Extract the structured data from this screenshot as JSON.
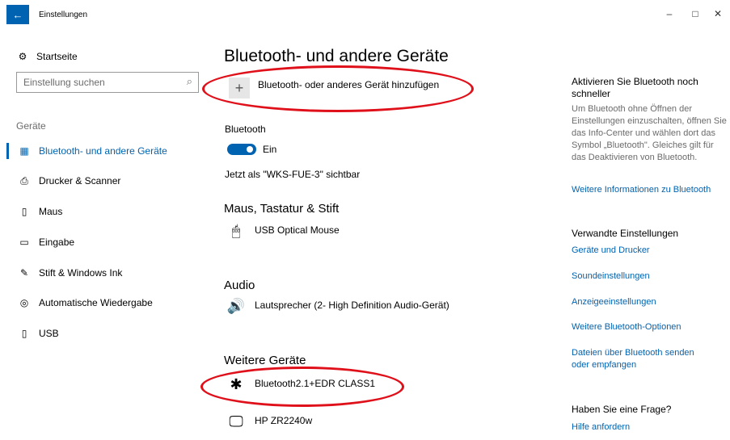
{
  "window": {
    "title": "Einstellungen",
    "back": "←",
    "controls": {
      "minimize": "–",
      "maximize": "□",
      "close": "✕"
    }
  },
  "sidebar": {
    "home": {
      "icon": "gear-icon",
      "glyph": "⚙",
      "label": "Startseite"
    },
    "search": {
      "placeholder": "Einstellung suchen",
      "glyph": "⌕"
    },
    "section": "Geräte",
    "items": [
      {
        "label": "Bluetooth- und andere Geräte",
        "icon": "devices-icon",
        "glyph": "▦",
        "active": true
      },
      {
        "label": "Drucker & Scanner",
        "icon": "printer-icon",
        "glyph": "⎙",
        "active": false
      },
      {
        "label": "Maus",
        "icon": "mouse-icon",
        "glyph": "▯",
        "active": false
      },
      {
        "label": "Eingabe",
        "icon": "keyboard-icon",
        "glyph": "▭",
        "active": false
      },
      {
        "label": "Stift & Windows Ink",
        "icon": "pen-icon",
        "glyph": "✎",
        "active": false
      },
      {
        "label": "Automatische Wiedergabe",
        "icon": "autoplay-icon",
        "glyph": "◎",
        "active": false
      },
      {
        "label": "USB",
        "icon": "usb-icon",
        "glyph": "▯",
        "active": false
      }
    ]
  },
  "main": {
    "title": "Bluetooth- und andere Geräte",
    "add_device": {
      "glyph": "+",
      "label": "Bluetooth- oder anderes Gerät hinzufügen"
    },
    "bluetooth": {
      "label": "Bluetooth",
      "state": "Ein",
      "on": true
    },
    "visibility": "Jetzt als \"WKS-FUE-3\" sichtbar",
    "groups": [
      {
        "title": "Maus, Tastatur & Stift",
        "devices": [
          {
            "name": "USB Optical Mouse",
            "icon": "mouse-icon",
            "glyph": "🖱"
          }
        ]
      },
      {
        "title": "Audio",
        "devices": [
          {
            "name": "Lautsprecher (2- High Definition Audio-Gerät)",
            "icon": "speaker-icon",
            "glyph": "🔊"
          }
        ]
      },
      {
        "title": "Weitere Geräte",
        "devices": [
          {
            "name": "Bluetooth2.1+EDR CLASS1",
            "icon": "bluetooth-icon",
            "glyph": "✱"
          },
          {
            "name": "HP ZR2240w",
            "icon": "monitor-icon",
            "glyph": "🖵"
          }
        ]
      }
    ]
  },
  "right": {
    "activate_heading": "Aktivieren Sie Bluetooth noch schneller",
    "activate_text": "Um Bluetooth ohne Öffnen der Einstellungen einzuschalten, öffnen Sie das Info-Center und wählen dort das Symbol „Bluetooth\". Gleiches gilt für das Deaktivieren von Bluetooth.",
    "more_info_link": "Weitere Informationen zu Bluetooth",
    "related_heading": "Verwandte Einstellungen",
    "related_links": [
      "Geräte und Drucker",
      "Soundeinstellungen",
      "Anzeigeeinstellungen",
      "Weitere Bluetooth-Optionen",
      "Dateien über Bluetooth senden oder empfangen"
    ],
    "question_heading": "Haben Sie eine Frage?",
    "help_link": "Hilfe anfordern"
  },
  "colors": {
    "accent": "#0063b1",
    "highlight_oval": "#e0101a"
  }
}
